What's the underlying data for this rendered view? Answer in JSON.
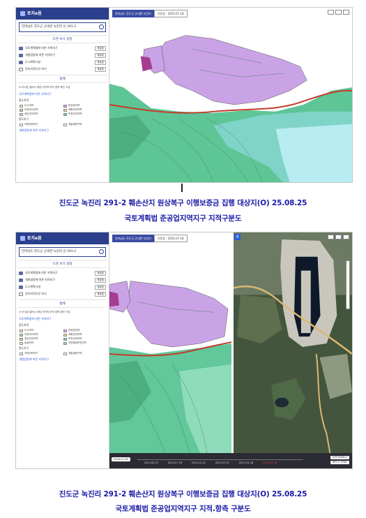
{
  "app": {
    "logo_text": "토지e음",
    "search_text": "전라남도 진도군 군내면 녹진리 산 291-2",
    "section_title": "도면 보기 설정",
    "layers": [
      {
        "label": "국토계획법에 따른 지역지구",
        "button": "색상표"
      },
      {
        "label": "개발법령에 따른 지역지구",
        "button": "색상표"
      },
      {
        "label": "도시계획시설",
        "button": "색상표"
      },
      {
        "label": "연속지적도만 보기",
        "button": "색상표"
      }
    ],
    "legend_title": "범례",
    "legend_note": "※ 아이콘 클릭시 해당 지역지구의 영역 확인 가능",
    "legend_group_title": "국토계획법에 따른 지역지구",
    "legend_zone_heading": "용도지역",
    "legend_items": [
      {
        "label": "도시지역",
        "color": "#f3e8b0"
      },
      {
        "label": "준공업지역",
        "color": "#c9a3e6"
      },
      {
        "label": "자연녹지지역",
        "color": "#9ee39a"
      },
      {
        "label": "계획관리지역",
        "color": "#ffd27a"
      },
      {
        "label": "생산관리지역",
        "color": "#bfe39a"
      },
      {
        "label": "보전관리지역",
        "color": "#6fcf9e"
      },
      {
        "label": "농림지역",
        "color": "#e8f19a"
      },
      {
        "label": "자연환경보전지역",
        "color": "#7fd3c7"
      }
    ],
    "legend_district_heading": "용도지구",
    "legend_district_items": [
      {
        "label": "자연취락지구",
        "color": "#ffffff"
      },
      {
        "label": "개발제한구역",
        "color": "#ffffff"
      }
    ],
    "legend_footer": "개발법령에 따른 지역지구"
  },
  "map1": {
    "region_label": "전라남도 진도군 군내면 녹진리",
    "date_label": "기준일 : 2025.07.18"
  },
  "map2": {
    "region_label": "전라남도 진도군 군내면 녹진리",
    "date_label": "기준일 : 2025.07.18",
    "close_label": "X",
    "timeline_select": "2025.07.18",
    "timeline_ticks": [
      "2024.04.27",
      "2024.07.09",
      "2024.10.21",
      "2025.03.07",
      "2025.04.26",
      "2025.07.18"
    ],
    "timeline_active_index": 5,
    "controls": [
      "도면 비교하기",
      "축척 1:7556"
    ]
  },
  "captions": {
    "caption1_line1": "진도군 녹진리 291-2 훼손산지 원상복구 이행보증금 집행 대상지(O) 25.08.25",
    "caption1_line2": "국토계획법 준공업지역지구 지적구분도",
    "caption2_line1": "진도군 녹진리 291-2 훼손산지 원상복구 이행보증금 집행 대상지(O) 25.08.25",
    "caption2_line2": "국토계획법 준공업지역지구 지적.항측 구분도"
  }
}
